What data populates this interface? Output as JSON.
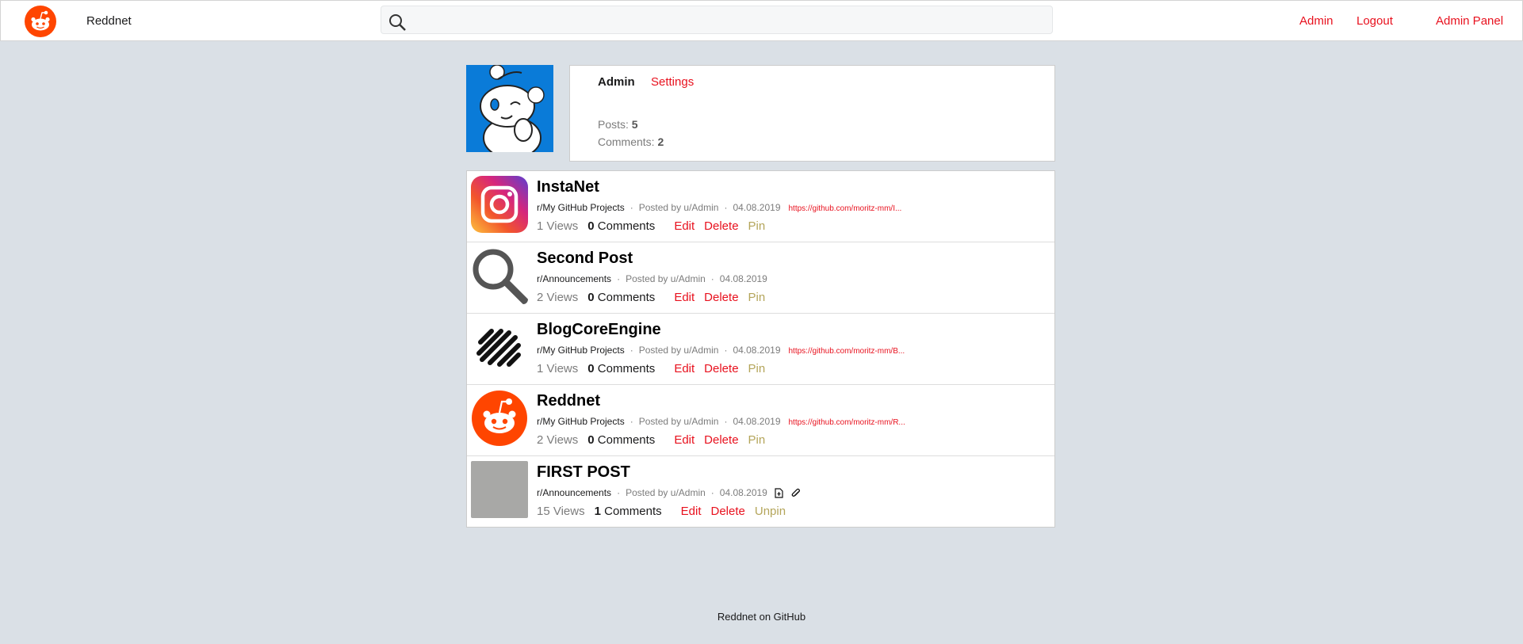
{
  "header": {
    "brand": "Reddnet",
    "search_placeholder": "",
    "nav": [
      "Admin",
      "Logout",
      "Admin Panel"
    ]
  },
  "profile": {
    "name": "Admin",
    "settings_label": "Settings",
    "posts_label": "Posts:",
    "posts_count": "5",
    "comments_label": "Comments:",
    "comments_count": "2"
  },
  "posts": [
    {
      "title": "InstaNet",
      "subreddit": "r/My GitHub Projects",
      "posted_by": "Posted by u/Admin",
      "date": "04.08.2019",
      "link": "https://github.com/moritz-mm/I...",
      "views": "1 Views",
      "comments_count": "0",
      "comments_label": "Comments",
      "edit": "Edit",
      "delete": "Delete",
      "pin": "Pin",
      "thumb_icon": "instagram-icon"
    },
    {
      "title": "Second Post",
      "subreddit": "r/Announcements",
      "posted_by": "Posted by u/Admin",
      "date": "04.08.2019",
      "link": "",
      "views": "2 Views",
      "comments_count": "0",
      "comments_label": "Comments",
      "edit": "Edit",
      "delete": "Delete",
      "pin": "Pin",
      "thumb_icon": "magnifier-icon"
    },
    {
      "title": "BlogCoreEngine",
      "subreddit": "r/My GitHub Projects",
      "posted_by": "Posted by u/Admin",
      "date": "04.08.2019",
      "link": "https://github.com/moritz-mm/B...",
      "views": "1 Views",
      "comments_count": "0",
      "comments_label": "Comments",
      "edit": "Edit",
      "delete": "Delete",
      "pin": "Pin",
      "thumb_icon": "stripes-logo-icon"
    },
    {
      "title": "Reddnet",
      "subreddit": "r/My GitHub Projects",
      "posted_by": "Posted by u/Admin",
      "date": "04.08.2019",
      "link": "https://github.com/moritz-mm/R...",
      "views": "2 Views",
      "comments_count": "0",
      "comments_label": "Comments",
      "edit": "Edit",
      "delete": "Delete",
      "pin": "Pin",
      "thumb_icon": "reddit-alien-icon"
    },
    {
      "title": "FIRST POST",
      "subreddit": "r/Announcements",
      "posted_by": "Posted by u/Admin",
      "date": "04.08.2019",
      "link": "",
      "views": "15 Views",
      "comments_count": "1",
      "comments_label": "Comments",
      "edit": "Edit",
      "delete": "Delete",
      "pin": "Unpin",
      "thumb_icon": "placeholder-image"
    }
  ],
  "footer": {
    "text": "Reddnet on GitHub"
  },
  "colors": {
    "accent": "#e8111e",
    "background": "#dae0e6",
    "pin": "#b4a55a",
    "brand_orange": "#ff4500"
  }
}
